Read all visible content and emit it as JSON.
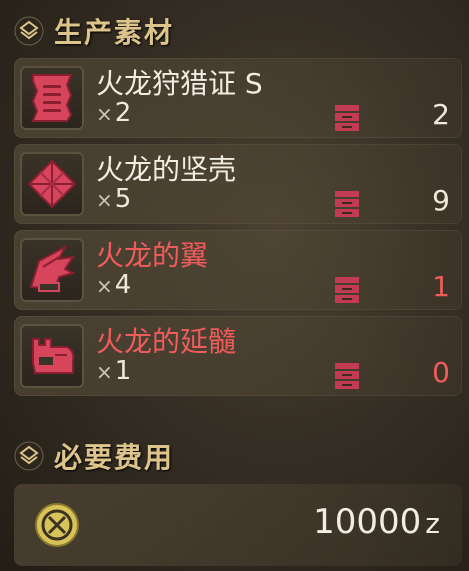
{
  "sections": {
    "materials_title": "生产素材",
    "cost_title": "必要费用"
  },
  "materials": [
    {
      "name": "火龙狩猎证 S",
      "required": "2",
      "owned": "2",
      "sufficient": true,
      "icon": "ticket-icon"
    },
    {
      "name": "火龙的坚壳",
      "required": "5",
      "owned": "9",
      "sufficient": true,
      "icon": "shell-icon"
    },
    {
      "name": "火龙的翼",
      "required": "4",
      "owned": "1",
      "sufficient": false,
      "icon": "wing-icon"
    },
    {
      "name": "火龙的延髓",
      "required": "1",
      "owned": "0",
      "sufficient": false,
      "icon": "medulla-icon"
    }
  ],
  "times_symbol": "×",
  "cost": {
    "amount": "10000",
    "unit": "z"
  },
  "colors": {
    "header": "#dcc48a",
    "normal_text": "#f1ede2",
    "lacking_text": "#ee5c5c",
    "item_red": "#d6455b"
  }
}
